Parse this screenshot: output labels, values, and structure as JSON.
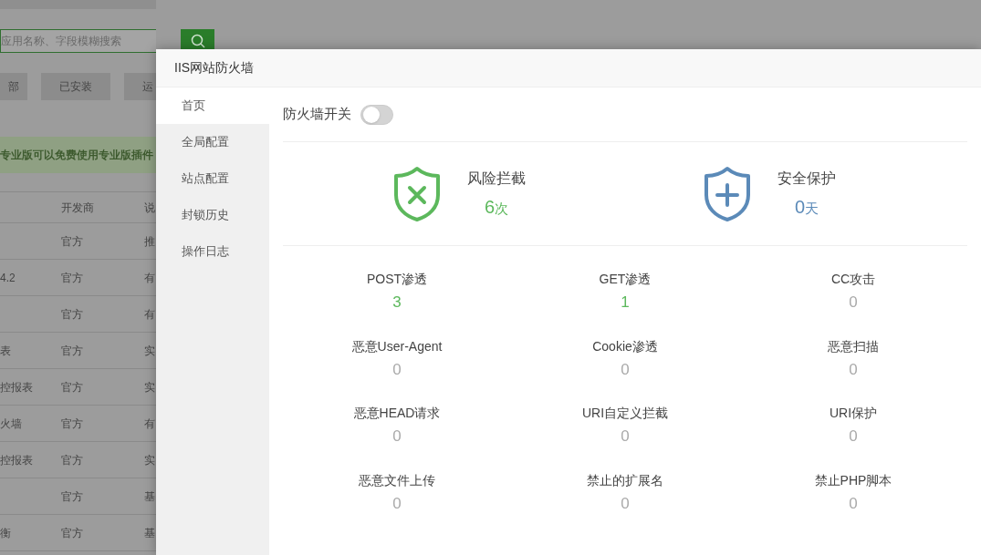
{
  "background": {
    "search": {
      "placeholder": "应用名称、字段模糊搜索"
    },
    "filters": [
      {
        "label": "部"
      },
      {
        "label": "已安装"
      },
      {
        "label": "运"
      }
    ],
    "banner": "专业版可以免费使用专业版插件",
    "table": {
      "columns": [
        "开发商",
        "说"
      ],
      "rows": [
        {
          "developer": "官方",
          "column_3": "推"
        },
        {
          "column_1": "4.2",
          "developer": "官方",
          "column_3": "有"
        },
        {
          "developer": "官方",
          "column_3": "有"
        },
        {
          "column_1": "表",
          "developer": "官方",
          "column_3": "实"
        },
        {
          "column_1": "控报表",
          "developer": "官方",
          "column_3": "实"
        },
        {
          "column_1": "火墙",
          "developer": "官方",
          "column_3": "有"
        },
        {
          "column_1": "控报表",
          "developer": "官方",
          "column_3": "实"
        },
        {
          "developer": "官方",
          "column_3": "基"
        },
        {
          "column_1": "衡",
          "developer": "官方",
          "column_3": "基"
        }
      ]
    }
  },
  "dialog": {
    "title": "IIS网站防火墙",
    "nav": [
      {
        "label": "首页",
        "selected": true
      },
      {
        "label": "全局配置",
        "selected": false
      },
      {
        "label": "站点配置",
        "selected": false
      },
      {
        "label": "封锁历史",
        "selected": false
      },
      {
        "label": "操作日志",
        "selected": false
      }
    ],
    "firewall_toggle": {
      "label": "防火墙开关",
      "on": false
    },
    "summary": [
      {
        "kind": "blocked",
        "label": "风险拦截",
        "value": "6",
        "unit": "次"
      },
      {
        "kind": "protected",
        "label": "安全保护",
        "value": "0",
        "unit": "天"
      }
    ],
    "stats": [
      {
        "label": "POST渗透",
        "value": "3",
        "color": "#5cb85c"
      },
      {
        "label": "GET渗透",
        "value": "1",
        "color": "#5cb85c"
      },
      {
        "label": "CC攻击",
        "value": "0",
        "color": "#aaaaaa"
      },
      {
        "label": "恶意User-Agent",
        "value": "0",
        "color": "#aaaaaa"
      },
      {
        "label": "Cookie渗透",
        "value": "0",
        "color": "#aaaaaa"
      },
      {
        "label": "恶意扫描",
        "value": "0",
        "color": "#aaaaaa"
      },
      {
        "label": "恶意HEAD请求",
        "value": "0",
        "color": "#aaaaaa"
      },
      {
        "label": "URI自定义拦截",
        "value": "0",
        "color": "#aaaaaa"
      },
      {
        "label": "URI保护",
        "value": "0",
        "color": "#aaaaaa"
      },
      {
        "label": "恶意文件上传",
        "value": "0",
        "color": "#aaaaaa"
      },
      {
        "label": "禁止的扩展名",
        "value": "0",
        "color": "#aaaaaa"
      },
      {
        "label": "禁止PHP脚本",
        "value": "0",
        "color": "#aaaaaa"
      }
    ]
  }
}
